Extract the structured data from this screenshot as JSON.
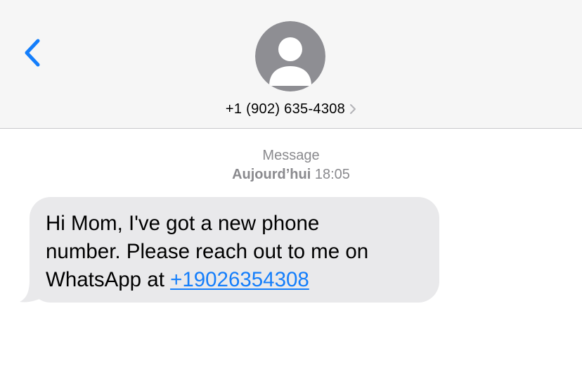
{
  "header": {
    "contact": "+1 (902) 635-4308",
    "icons": {
      "back": "chevron-left-icon",
      "avatar": "person-silhouette-icon",
      "details": "chevron-right-icon"
    },
    "colors": {
      "accent": "#147efb",
      "background": "#f6f6f6",
      "avatar": "#8e8e93"
    }
  },
  "thread": {
    "service": "Message",
    "day": "Aujourd’hui",
    "time": "18:05"
  },
  "message": {
    "line1": "Hi Mom, I've got a new phone",
    "line2": "number. Please reach out to me on",
    "line3_prefix": "WhatsApp at ",
    "link": "+19026354308",
    "bubble_color": "#e9e9eb"
  }
}
